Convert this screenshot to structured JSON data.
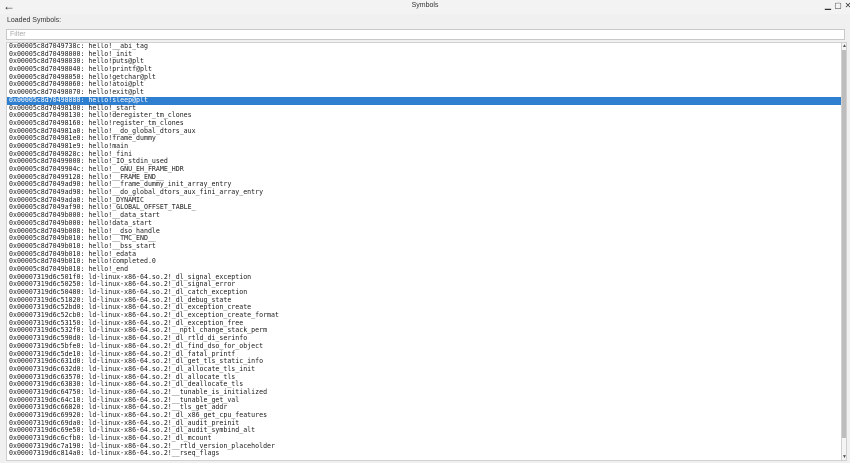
{
  "window": {
    "title": "Symbols",
    "back_icon": "←",
    "min_icon": "▁",
    "max_icon": "▢",
    "close_icon": "✕"
  },
  "loaded_label": "Loaded Symbols:",
  "filter": {
    "placeholder": "Filter",
    "value": ""
  },
  "selected_index": 7,
  "symbols": [
    "0x00005c8d7049738c: hello!__abi_tag",
    "0x00005c8d70498000: hello!_init",
    "0x00005c8d70498030: hello!puts@plt",
    "0x00005c8d70498040: hello!printf@plt",
    "0x00005c8d70498050: hello!getchar@plt",
    "0x00005c8d70498060: hello!atoi@plt",
    "0x00005c8d70498070: hello!exit@plt",
    "0x00005c8d70498080: hello!sleep@plt",
    "0x00005c8d70498100: hello!_start",
    "0x00005c8d70498130: hello!deregister_tm_clones",
    "0x00005c8d70498160: hello!register_tm_clones",
    "0x00005c8d704981a0: hello!__do_global_dtors_aux",
    "0x00005c8d704981e0: hello!frame_dummy",
    "0x00005c8d704981e9: hello!main",
    "0x00005c8d7049828c: hello!_fini",
    "0x00005c8d70499000: hello!_IO_stdin_used",
    "0x00005c8d7049904c: hello!__GNU_EH_FRAME_HDR",
    "0x00005c8d70499128: hello!__FRAME_END__",
    "0x00005c8d7049ad90: hello!__frame_dummy_init_array_entry",
    "0x00005c8d7049ad98: hello!__do_global_dtors_aux_fini_array_entry",
    "0x00005c8d7049ada0: hello!_DYNAMIC",
    "0x00005c8d7049af90: hello!_GLOBAL_OFFSET_TABLE_",
    "0x00005c8d7049b000: hello!__data_start",
    "0x00005c8d7049b000: hello!data_start",
    "0x00005c8d7049b008: hello!__dso_handle",
    "0x00005c8d7049b010: hello!__TMC_END__",
    "0x00005c8d7049b010: hello!__bss_start",
    "0x00005c8d7049b010: hello!_edata",
    "0x00005c8d7049b010: hello!completed.0",
    "0x00005c8d7049b018: hello!_end",
    "0x00007319d6c501f0: ld-linux-x86-64.so.2!_dl_signal_exception",
    "0x00007319d6c50250: ld-linux-x86-64.so.2!_dl_signal_error",
    "0x00007319d6c50480: ld-linux-x86-64.so.2!_dl_catch_exception",
    "0x00007319d6c51820: ld-linux-x86-64.so.2!_dl_debug_state",
    "0x00007319d6c52bd0: ld-linux-x86-64.so.2!_dl_exception_create",
    "0x00007319d6c52cb0: ld-linux-x86-64.so.2!_dl_exception_create_format",
    "0x00007319d6c53150: ld-linux-x86-64.so.2!_dl_exception_free",
    "0x00007319d6c532f0: ld-linux-x86-64.so.2!__nptl_change_stack_perm",
    "0x00007319d6c590d0: ld-linux-x86-64.so.2!_dl_rtld_di_serinfo",
    "0x00007319d6c5bfe0: ld-linux-x86-64.so.2!_dl_find_dso_for_object",
    "0x00007319d6c5de10: ld-linux-x86-64.so.2!_dl_fatal_printf",
    "0x00007319d6c631d0: ld-linux-x86-64.so.2!_dl_get_tls_static_info",
    "0x00007319d6c632d0: ld-linux-x86-64.so.2!_dl_allocate_tls_init",
    "0x00007319d6c63570: ld-linux-x86-64.so.2!_dl_allocate_tls",
    "0x00007319d6c63830: ld-linux-x86-64.so.2!_dl_deallocate_tls",
    "0x00007319d6c64750: ld-linux-x86-64.so.2!__tunable_is_initialized",
    "0x00007319d6c64c10: ld-linux-x86-64.so.2!__tunable_get_val",
    "0x00007319d6c66820: ld-linux-x86-64.so.2!__tls_get_addr",
    "0x00007319d6c69920: ld-linux-x86-64.so.2!_dl_x86_get_cpu_features",
    "0x00007319d6c69da0: ld-linux-x86-64.so.2!_dl_audit_preinit",
    "0x00007319d6c69e50: ld-linux-x86-64.so.2!_dl_audit_symbind_alt",
    "0x00007319d6c6cfb0: ld-linux-x86-64.so.2!_dl_mcount",
    "0x00007319d6c7a190: ld-linux-x86-64.so.2!__rtld_version_placeholder",
    "0x00007319d6c814a0: ld-linux-x86-64.so.2!__rseq_flags"
  ]
}
